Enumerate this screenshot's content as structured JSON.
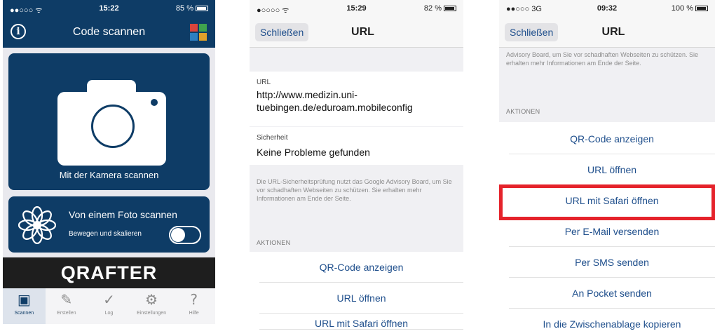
{
  "phone1": {
    "status": {
      "signal": "●●○○○ ᯤ",
      "time": "15:22",
      "battery": "85 %"
    },
    "title": "Code scannen",
    "camera_label": "Mit der Kamera scannen",
    "photo_label": "Von einem Foto scannen",
    "move_label": "Bewegen und skalieren",
    "brand": "QRAFTER",
    "tabs": [
      {
        "label": "Scannen",
        "icon": "phone-scan-icon"
      },
      {
        "label": "Erstellen",
        "icon": "pencil-icon"
      },
      {
        "label": "Log",
        "icon": "check-circle-icon"
      },
      {
        "label": "Einstellungen",
        "icon": "gear-icon"
      },
      {
        "label": "Hilfe",
        "icon": "help-icon"
      }
    ]
  },
  "phone2": {
    "status": {
      "signal": "●○○○○ ᯤ",
      "time": "15:29",
      "battery": "82 %"
    },
    "back_label": "Schließen",
    "title": "URL",
    "url_label": "URL",
    "url_value": "http://www.medizin.uni-tuebingen.de/eduroam.mobileconfig",
    "security_label": "Sicherheit",
    "security_value": "Keine Probleme gefunden",
    "footnote": "Die URL-Sicherheitsprüfung nutzt das Google Advisory Board, um Sie vor schadhaften Webseiten zu schützen. Sie erhalten mehr Informationen am Ende der Seite.",
    "actions_header": "AKTIONEN",
    "actions": [
      "QR-Code anzeigen",
      "URL öffnen",
      "URL mit Safari öffnen"
    ]
  },
  "phone3": {
    "status": {
      "signal": "●●○○○ 3G",
      "time": "09:32",
      "battery": "100 %"
    },
    "back_label": "Schließen",
    "title": "URL",
    "footnote": "Advisory Board, um Sie vor schadhaften Webseiten zu schützen. Sie erhalten mehr Informationen am Ende der Seite.",
    "actions_header": "AKTIONEN",
    "actions": [
      "QR-Code anzeigen",
      "URL öffnen",
      "URL mit Safari öffnen",
      "Per E-Mail versenden",
      "Per SMS senden",
      "An Pocket senden",
      "In die Zwischenablage kopieren"
    ],
    "highlight_color": "#e5232b"
  },
  "colors": {
    "brand_blue": "#0e3c66",
    "link_blue": "#1f4f8c"
  }
}
